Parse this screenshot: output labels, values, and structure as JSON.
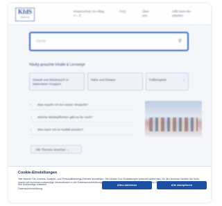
{
  "header": {
    "logo_text": "KfdS",
    "logo_subtext": "SERVICE",
    "nav": [
      {
        "line1": "Kinderschutz im Alltag",
        "line2": "A – Z"
      },
      {
        "line1": "FAQ",
        "line2": ""
      },
      {
        "line1": "Über",
        "line2": "uns"
      },
      {
        "line1": "Hilfe beim Be-",
        "line2": "arbeiten"
      }
    ]
  },
  "search": {
    "placeholder": "Suche"
  },
  "section": {
    "title": "Häufig gesuchte Inhalte & Lernwege"
  },
  "chips": [
    {
      "label": "Gewalt und Missbrauch in stationären Gruppen"
    },
    {
      "label": "Nähe und Distanz"
    },
    {
      "label": "Fallbeispiele"
    }
  ],
  "faq": [
    {
      "label": "Was mache ich bei einem Verdacht?"
    },
    {
      "label": "Welche Meldepflichten gibt es für mich?"
    },
    {
      "label": "Wen kann ich im Notfall anrufen?"
    }
  ],
  "more_button": {
    "label": "Alle Themen ansehen"
  },
  "cookie": {
    "title": "Cookie-Einstellungen",
    "text": "Hier können Sie Cookies, Analyse- und Personalisierungs-Dienste auswählen. Sie können Ihre Einstellungen jederzeit widerrufen, für den sicheren Betrieb der Seite nutzen wir technisch notwendige Informationen in der Datenschutzerklärung. Diese Einstellungen gelten für die Website des KfdS.",
    "link_settings": "Nur Notwendige zulassen",
    "link_privacy": "Datenschutzerklärung",
    "btn_accept_selected": "Alles ablehnen",
    "btn_accept_all": "Alle akzeptieren"
  }
}
